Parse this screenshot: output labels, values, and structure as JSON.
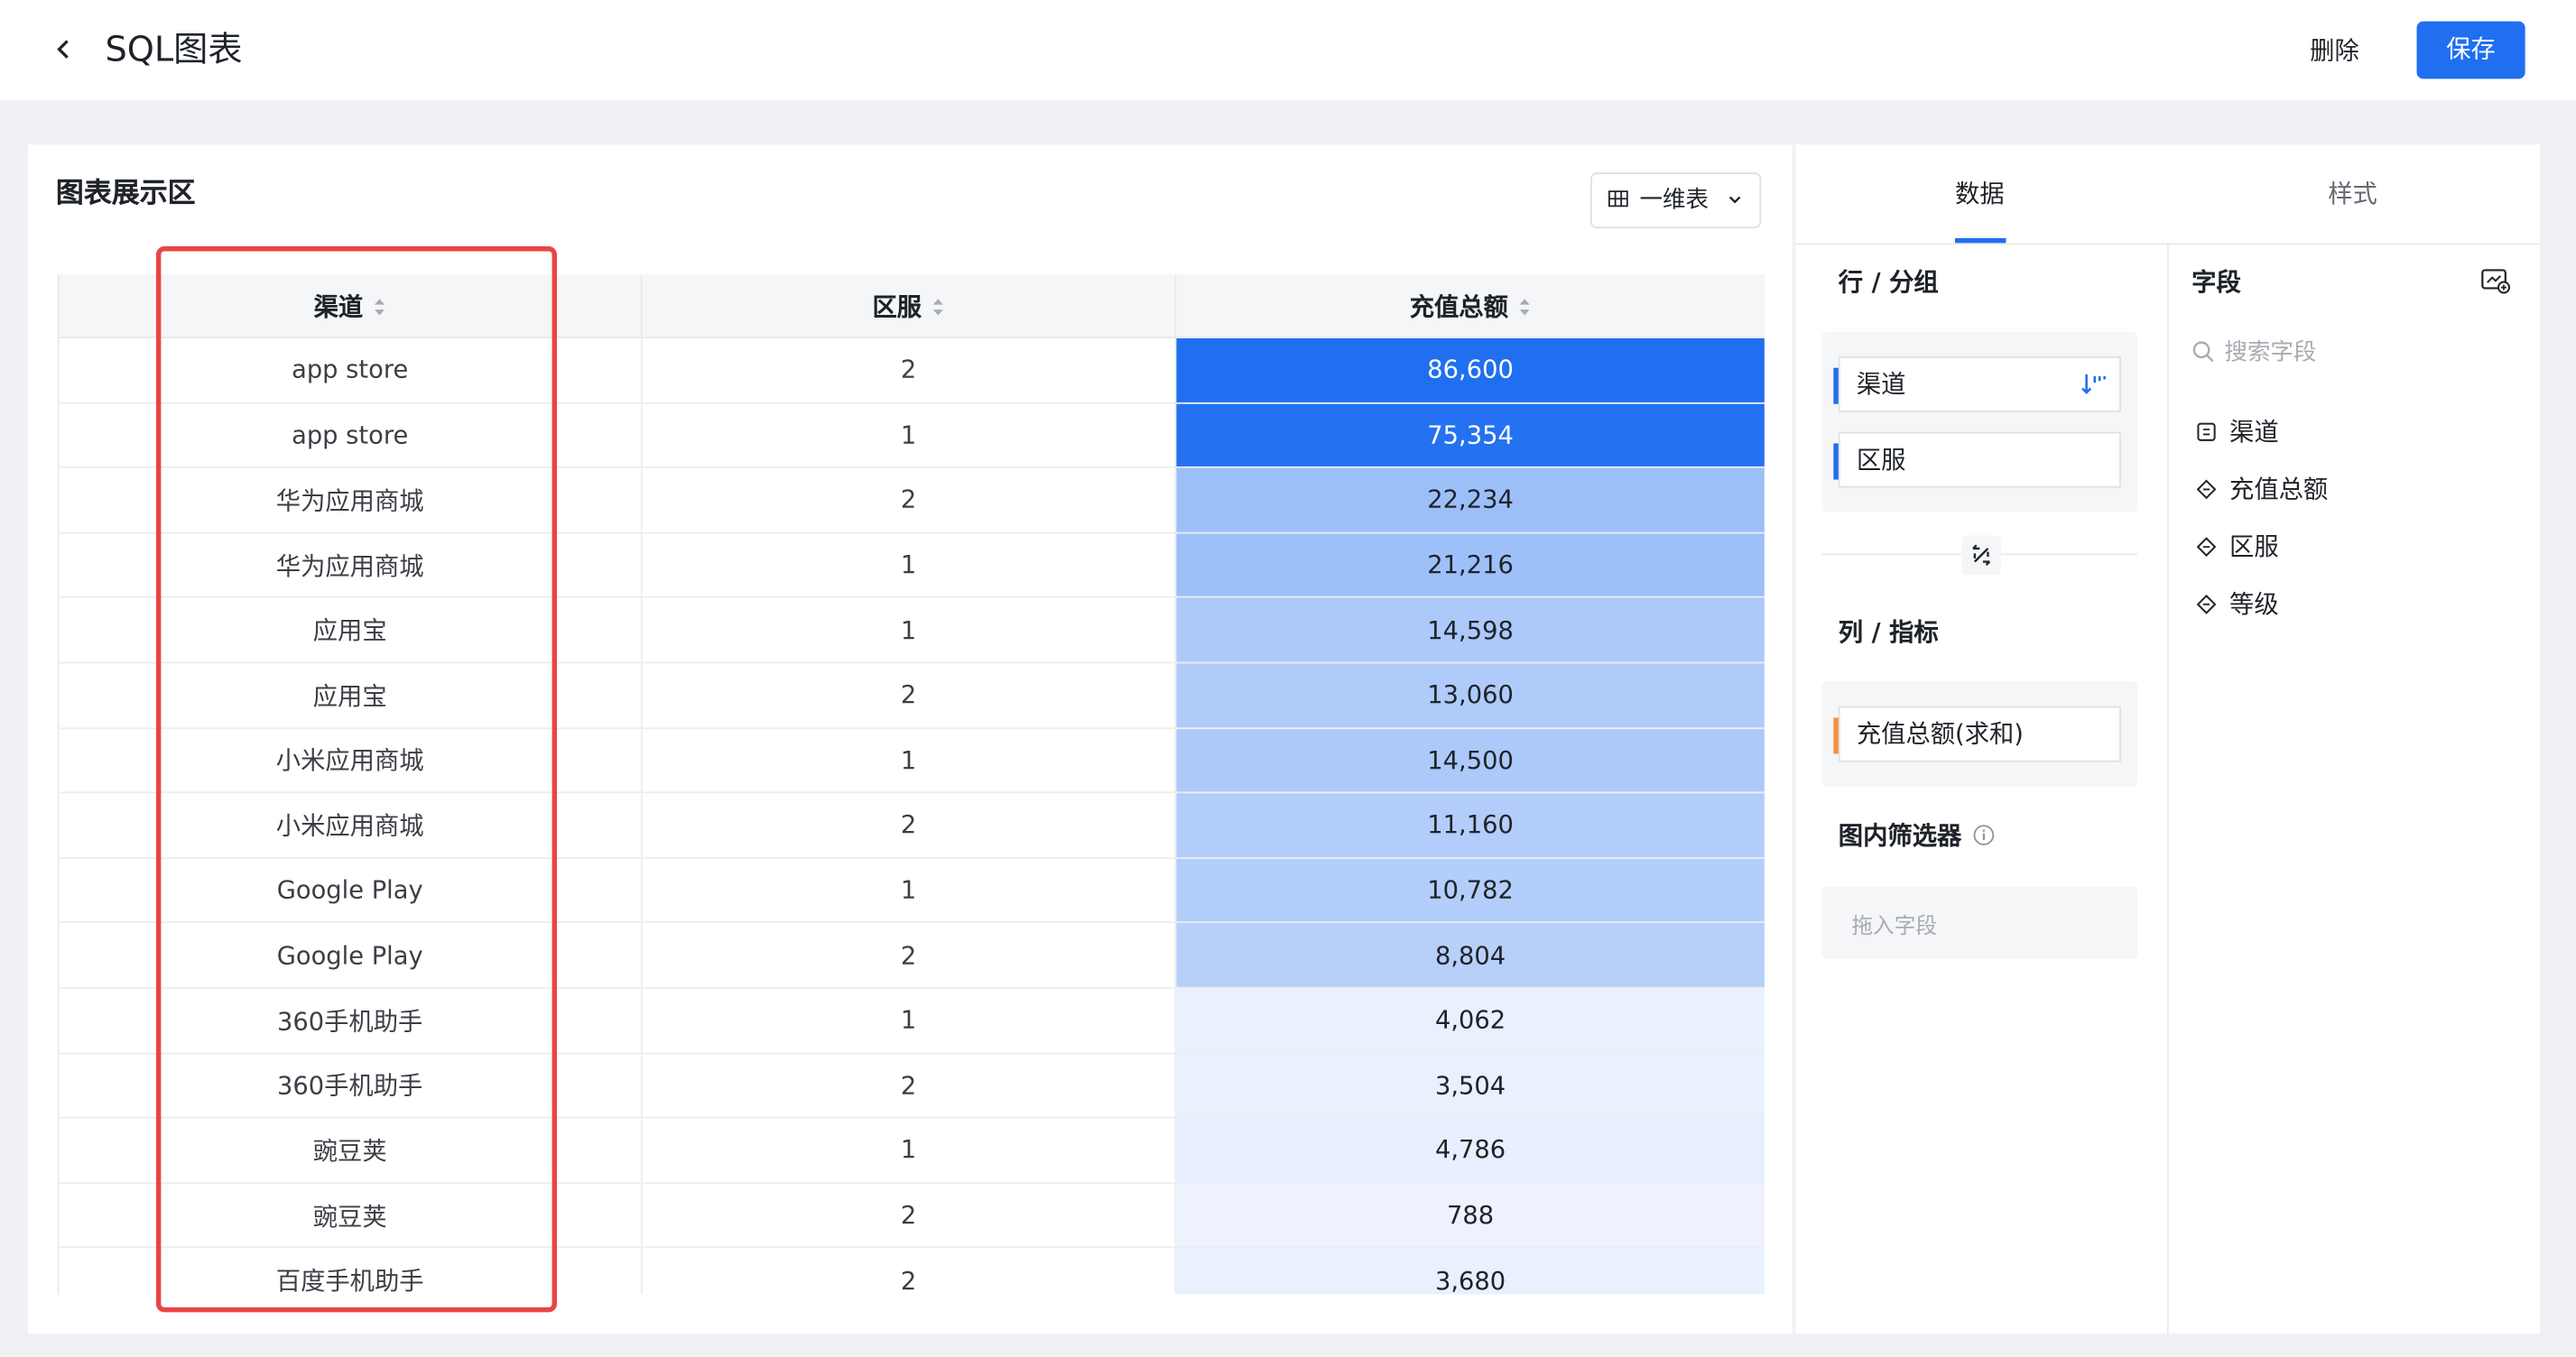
{
  "header": {
    "back_icon": "chevron-left-icon",
    "title": "SQL图表",
    "delete_label": "删除",
    "save_label": "保存"
  },
  "chart_area": {
    "title": "图表展示区",
    "chart_type": "一维表",
    "chart_type_icon": "table-grid-icon"
  },
  "table": {
    "columns": [
      "渠道",
      "区服",
      "充值总额"
    ],
    "rows": [
      {
        "channel": "app store",
        "server": "2",
        "amount": "86,600",
        "value": 86600
      },
      {
        "channel": "app store",
        "server": "1",
        "amount": "75,354",
        "value": 75354
      },
      {
        "channel": "华为应用商城",
        "server": "2",
        "amount": "22,234",
        "value": 22234
      },
      {
        "channel": "华为应用商城",
        "server": "1",
        "amount": "21,216",
        "value": 21216
      },
      {
        "channel": "应用宝",
        "server": "1",
        "amount": "14,598",
        "value": 14598
      },
      {
        "channel": "应用宝",
        "server": "2",
        "amount": "13,060",
        "value": 13060
      },
      {
        "channel": "小米应用商城",
        "server": "1",
        "amount": "14,500",
        "value": 14500
      },
      {
        "channel": "小米应用商城",
        "server": "2",
        "amount": "11,160",
        "value": 11160
      },
      {
        "channel": "Google Play",
        "server": "1",
        "amount": "10,782",
        "value": 10782
      },
      {
        "channel": "Google Play",
        "server": "2",
        "amount": "8,804",
        "value": 8804
      },
      {
        "channel": "360手机助手",
        "server": "1",
        "amount": "4,062",
        "value": 4062
      },
      {
        "channel": "360手机助手",
        "server": "2",
        "amount": "3,504",
        "value": 3504
      },
      {
        "channel": "豌豆荚",
        "server": "1",
        "amount": "4,786",
        "value": 4786
      },
      {
        "channel": "豌豆荚",
        "server": "2",
        "amount": "788",
        "value": 788
      },
      {
        "channel": "百度手机助手",
        "server": "2",
        "amount": "3,680",
        "value": 3680
      }
    ],
    "heat_colors": {
      "high": "#1f6ff0",
      "low": "#eef3fe"
    }
  },
  "config": {
    "tabs": [
      {
        "label": "数据",
        "active": true
      },
      {
        "label": "样式",
        "active": false
      }
    ],
    "rows_section": {
      "label": "行 / 分组",
      "fields": [
        {
          "label": "渠道",
          "bar_color": "#1f6ff0",
          "sort": "desc"
        },
        {
          "label": "区服",
          "bar_color": "#1f6ff0"
        }
      ]
    },
    "swap_icon": "swap-axes-icon",
    "columns_section": {
      "label": "列 / 指标",
      "fields": [
        {
          "label": "充值总额(求和)",
          "bar_color": "#f5903d"
        }
      ]
    },
    "filter_section": {
      "label": "图内筛选器",
      "info_icon": "info-icon",
      "drop_hint": "拖入字段"
    },
    "fields_panel": {
      "title": "字段",
      "add_icon": "add-field-icon",
      "search_placeholder": "搜索字段",
      "items": [
        {
          "label": "渠道",
          "icon": "dimension-icon"
        },
        {
          "label": "充值总额",
          "icon": "measure-icon"
        },
        {
          "label": "区服",
          "icon": "measure-icon"
        },
        {
          "label": "等级",
          "icon": "measure-icon"
        }
      ]
    }
  }
}
